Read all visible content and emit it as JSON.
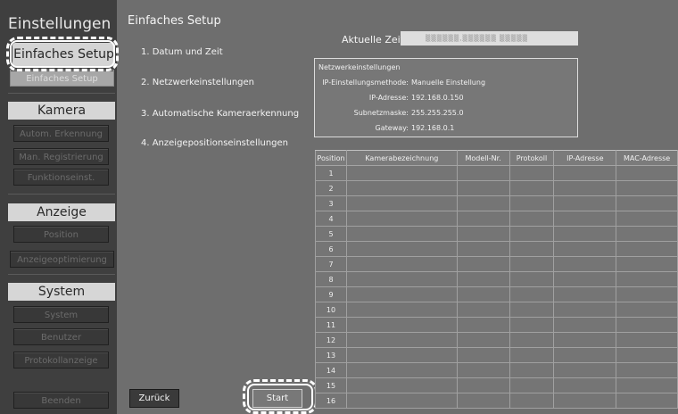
{
  "sidebar": {
    "title": "Einstellungen",
    "active_tab": "Einfaches Setup",
    "items": [
      {
        "label": "Einfaches Setup"
      },
      {
        "label": "Kamera"
      },
      {
        "label": "Autom. Erkennung"
      },
      {
        "label": "Man. Registrierung"
      },
      {
        "label": "Funktionseinst."
      },
      {
        "label": "Anzeige"
      },
      {
        "label": "Position"
      },
      {
        "label": "Anzeigeoptimierung"
      },
      {
        "label": "System"
      },
      {
        "label": "System"
      },
      {
        "label": "Benutzer"
      },
      {
        "label": "Protokollanzeige"
      },
      {
        "label": "Beenden"
      }
    ]
  },
  "main": {
    "title": "Einfaches Setup",
    "steps": [
      {
        "label": "1. Datum und Zeit"
      },
      {
        "label": "2. Netzwerkeinstellungen"
      },
      {
        "label": "3. Automatische Kameraerkennung"
      },
      {
        "label": "4. Anzeigepositionseinstellungen"
      }
    ],
    "time": {
      "label": "Aktuelle Zeit",
      "value": "▒▒▒▒▒▒,▒▒▒▒▒▒ ▒▒▒▒▒"
    },
    "network": {
      "title": "Netzwerkeinstellungen",
      "rows": [
        {
          "key": "IP-Einstellungsmethode:",
          "value": "Manuelle Einstellung"
        },
        {
          "key": "IP-Adresse:",
          "value": "192.168.0.150"
        },
        {
          "key": "Subnetzmaske:",
          "value": "255.255.255.0"
        },
        {
          "key": "Gateway:",
          "value": "192.168.0.1"
        }
      ]
    },
    "table": {
      "headers": [
        {
          "label": "Position"
        },
        {
          "label": "Kamerabezeichnung"
        },
        {
          "label": "Modell-Nr."
        },
        {
          "label": "Protokoll"
        },
        {
          "label": "IP-Adresse"
        },
        {
          "label": "MAC-Adresse"
        }
      ],
      "rows": [
        {
          "position": "1"
        },
        {
          "position": "2"
        },
        {
          "position": "3"
        },
        {
          "position": "4"
        },
        {
          "position": "5"
        },
        {
          "position": "6"
        },
        {
          "position": "7"
        },
        {
          "position": "8"
        },
        {
          "position": "9"
        },
        {
          "position": "10"
        },
        {
          "position": "11"
        },
        {
          "position": "12"
        },
        {
          "position": "13"
        },
        {
          "position": "14"
        },
        {
          "position": "15"
        },
        {
          "position": "16"
        }
      ]
    },
    "buttons": {
      "back": "Zurück",
      "start": "Start"
    }
  }
}
